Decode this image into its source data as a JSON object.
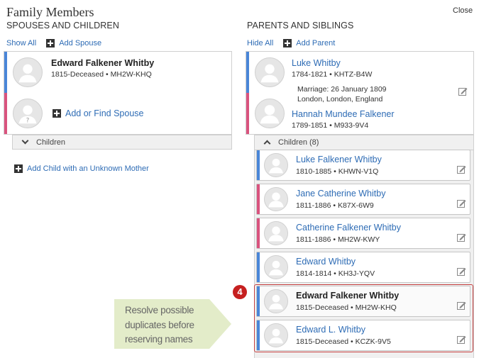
{
  "header": {
    "title": "Family Members",
    "close_label": "Close"
  },
  "left": {
    "heading": "SPOUSES AND CHILDREN",
    "show_all_label": "Show All",
    "add_spouse_label": "Add Spouse",
    "person": {
      "name": "Edward Falkener Whitby",
      "info": "1815-Deceased • MH2W-KHQ",
      "gender": "male"
    },
    "add_find_spouse_label": "Add or Find Spouse",
    "children_label": "Children",
    "add_child_unknown_mother_label": "Add Child with an Unknown Mother"
  },
  "right": {
    "heading": "PARENTS AND SIBLINGS",
    "hide_all_label": "Hide All",
    "add_parent_label": "Add Parent",
    "father": {
      "name": "Luke Whitby",
      "info": "1784-1821 • KHTZ-B4W",
      "gender": "male"
    },
    "marriage": {
      "line1": "Marriage: 26 January 1809",
      "line2": "London, London, England"
    },
    "mother": {
      "name": "Hannah Mundee Falkener",
      "info": "1789-1851 • M933-9V4",
      "gender": "female"
    },
    "children_label": "Children (8)",
    "children": [
      {
        "name": "Luke Falkener Whitby",
        "info": "1810-1885 • KHWN-V1Q",
        "gender": "male"
      },
      {
        "name": "Jane Catherine Whitby",
        "info": "1811-1886 • K87X-6W9",
        "gender": "female"
      },
      {
        "name": "Catherine Falkener Whitby",
        "info": "1811-1886 • MH2W-KWY",
        "gender": "female"
      },
      {
        "name": "Edward Whitby",
        "info": "1814-1814 • KH3J-YQV",
        "gender": "male"
      },
      {
        "name": "Edward Falkener Whitby",
        "info": "1815-Deceased • MH2W-KHQ",
        "gender": "male"
      },
      {
        "name": "Edward L. Whitby",
        "info": "1815-Deceased • KCZK-9V5",
        "gender": "male"
      }
    ]
  },
  "annotation": {
    "badge": "4",
    "callout_lines": [
      "Resolve possible",
      "duplicates before",
      "reserving names"
    ]
  },
  "colors": {
    "male": "#4a86d8",
    "female": "#d9537e",
    "link": "#2e6cb5",
    "badge": "#c62020",
    "callout": "#e3ecc9"
  },
  "icons": [
    "plus-icon",
    "person-silhouette-icon",
    "unknown-person-icon",
    "chevron-down-icon",
    "chevron-up-icon",
    "edit-icon"
  ]
}
